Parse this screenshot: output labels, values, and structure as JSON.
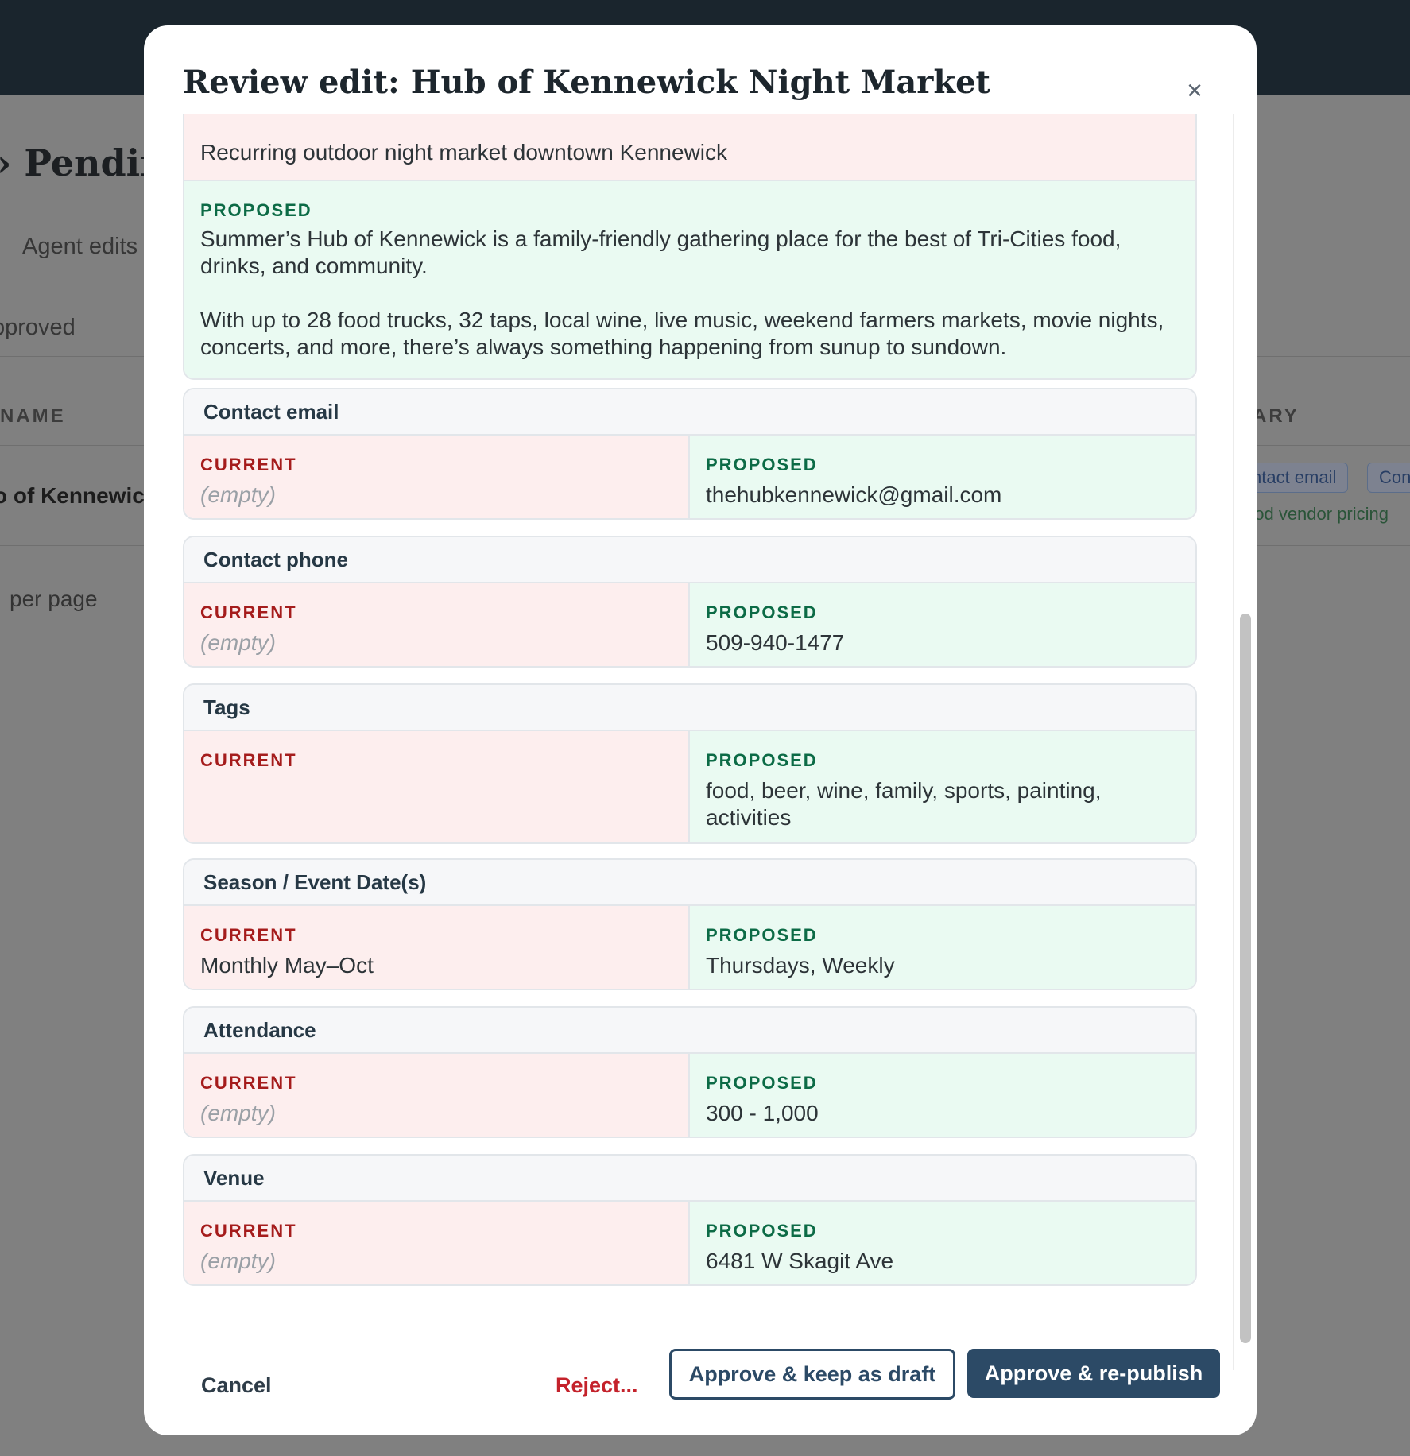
{
  "background": {
    "page_title_fragment": "› Pendin",
    "tab_agent_edits": "Agent edits",
    "filter_approved": "pproved",
    "col_name": "NAME",
    "col_summary_fragment": "ARY",
    "row_name_fragment": "o of Kennewick",
    "chip_contact_email": "ntact email",
    "chip_cont": "Con",
    "chip_food_vendor": "ood vendor pricing",
    "per_page": "per page"
  },
  "modal": {
    "title": "Review edit: Hub of Kennewick Night Market",
    "close_icon": "×",
    "description": {
      "current": "Recurring outdoor night market downtown Kennewick",
      "proposed_label": "PROPOSED",
      "proposed_p1": "Summer’s Hub of Kennewick is a family-friendly gathering place for the best of Tri-Cities food, drinks, and community.",
      "proposed_p2": "With up to 28 food trucks, 32 taps, local wine, live music, weekend farmers markets, movie nights, concerts, and more, there’s always something happening from sunup to sundown."
    },
    "labels": {
      "current": "CURRENT",
      "proposed": "PROPOSED"
    },
    "fields": [
      {
        "name": "Contact email",
        "current": "(empty)",
        "proposed": "thehubkennewick@gmail.com"
      },
      {
        "name": "Contact phone",
        "current": "(empty)",
        "proposed": "509-940-1477"
      },
      {
        "name": "Tags",
        "current": "",
        "proposed": "food, beer, wine, family, sports, painting, activities"
      },
      {
        "name": "Season / Event Date(s)",
        "current": "Monthly May–Oct",
        "proposed": "Thursdays, Weekly"
      },
      {
        "name": "Attendance",
        "current": "(empty)",
        "proposed": "300 - 1,000"
      },
      {
        "name": "Venue",
        "current": "(empty)",
        "proposed": "6481 W Skagit Ave"
      }
    ],
    "footer": {
      "cancel": "Cancel",
      "reject": "Reject...",
      "approve_draft": "Approve & keep as draft",
      "approve_publish": "Approve & re-publish"
    }
  },
  "colors": {
    "current_bg": "#fdeeee",
    "proposed_bg": "#eafaf2",
    "current_label": "#a51c1c",
    "proposed_label": "#0c6b46",
    "primary": "#2c4a66",
    "danger": "#c4222b"
  }
}
